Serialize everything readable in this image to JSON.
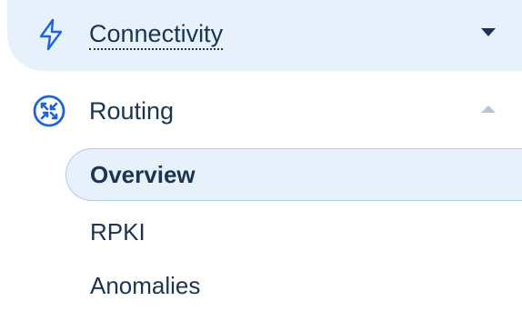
{
  "nav": {
    "items": [
      {
        "label": "Connectivity",
        "icon": "lightning-bolt-icon",
        "expanded": false,
        "active": true
      },
      {
        "label": "Routing",
        "icon": "routing-arrows-icon",
        "expanded": true,
        "active": false
      }
    ],
    "routing_subitems": [
      {
        "label": "Overview",
        "selected": true
      },
      {
        "label": "RPKI",
        "selected": false
      },
      {
        "label": "Anomalies",
        "selected": false
      }
    ]
  },
  "colors": {
    "text": "#1b3452",
    "accent": "#1f63d8",
    "active_bg": "#e6f1fb",
    "selected_border": "#a9cdee",
    "chevron_muted": "#b6c4d3"
  }
}
